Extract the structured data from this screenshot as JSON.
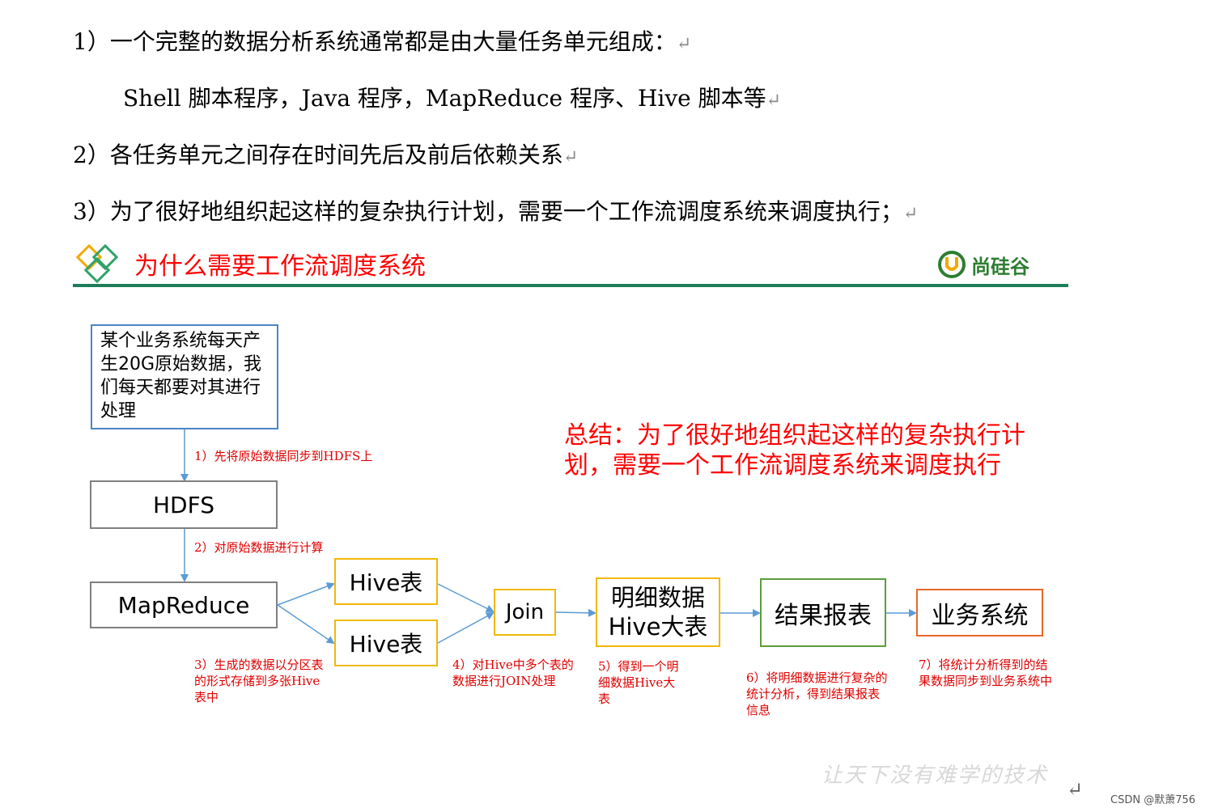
{
  "paragraphs": {
    "p1": "1）一个完整的数据分析系统通常都是由大量任务单元组成：",
    "p1_sub": "Shell 脚本程序，Java 程序，MapReduce 程序、Hive 脚本等",
    "p2": "2）各任务单元之间存在时间先后及前后依赖关系",
    "p3": "3）为了很好地组织起这样的复杂执行计划，需要一个工作流调度系统来调度执行；",
    "return_mark": "↵"
  },
  "header": {
    "title": "为什么需要工作流调度系统",
    "logo_text": "尚硅谷"
  },
  "diagram": {
    "source_box": "某个业务系统每天产生20G原始数据，我们每天都要对其进行处理",
    "hdfs": "HDFS",
    "mapreduce": "MapReduce",
    "hive_table_1": "Hive表",
    "hive_table_2": "Hive表",
    "join": "Join",
    "detail_line1": "明细数据",
    "detail_line2": "Hive大表",
    "result_report": "结果报表",
    "business_system": "业务系统",
    "note1": "1）先将原始数据同步到HDFS上",
    "note2": "2）对原始数据进行计算",
    "note3": "3）生成的数据以分区表的形式存储到多张Hive表中",
    "note4": "4）对Hive中多个表的数据进行JOIN处理",
    "note5": "5）得到一个明细数据Hive大表",
    "note6": "6）将明细数据进行复杂的统计分析，得到结果报表信息",
    "note7": "7）将统计分析得到的结果数据同步到业务系统中",
    "summary": "总结：为了很好地组织起这样的复杂执行计划，需要一个工作流调度系统来调度执行"
  },
  "footer": {
    "watermark": "让天下没有难学的技术",
    "csdn": "CSDN @默萧756"
  },
  "colors": {
    "accent_red": "#ff0000",
    "rule_green": "#1e7e5a",
    "arrow_blue": "#5b9bd5"
  }
}
